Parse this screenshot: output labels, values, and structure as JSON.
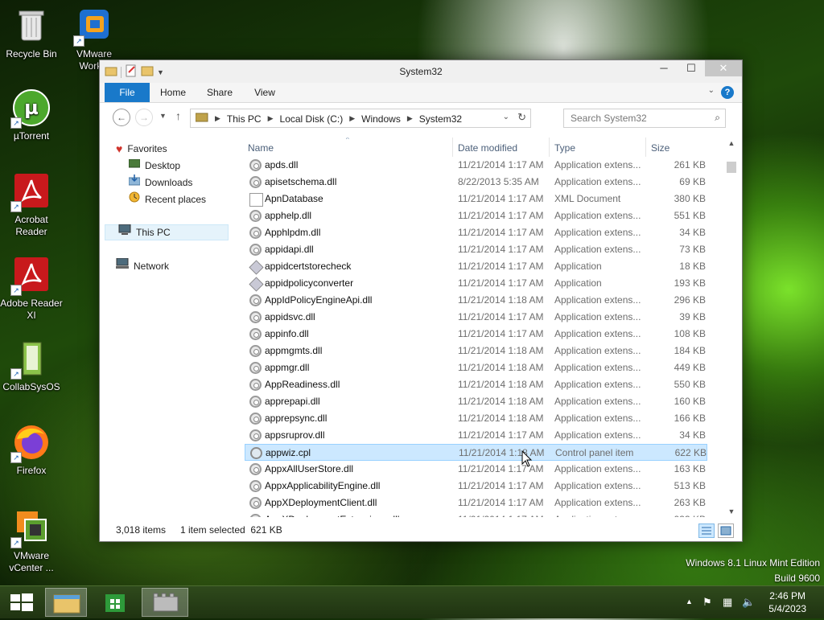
{
  "desktop": {
    "icons": [
      {
        "label": "Recycle Bin",
        "icon": "recycle-bin-icon"
      },
      {
        "label": "VMware Workst",
        "icon": "vmware-workstation-icon"
      },
      {
        "label": "µTorrent",
        "icon": "utorrent-icon"
      },
      {
        "label": "Acrobat Reader",
        "icon": "acrobat-reader-icon"
      },
      {
        "label": "Adobe Reader XI",
        "icon": "adobe-reader-icon"
      },
      {
        "label": "CollabSysOS",
        "icon": "collabsysos-icon"
      },
      {
        "label": "Firefox",
        "icon": "firefox-icon"
      },
      {
        "label": "VMware vCenter ...",
        "icon": "vmware-vcenter-icon"
      }
    ]
  },
  "window": {
    "title": "System32",
    "ribbon": {
      "file": "File",
      "home": "Home",
      "share": "Share",
      "view": "View"
    },
    "address": {
      "crumbs": [
        "This PC",
        "Local Disk (C:)",
        "Windows",
        "System32"
      ]
    },
    "search": {
      "placeholder": "Search System32"
    },
    "nav": {
      "favorites": "Favorites",
      "desktop": "Desktop",
      "downloads": "Downloads",
      "recent": "Recent places",
      "thispc": "This PC",
      "network": "Network"
    },
    "columns": {
      "name": "Name",
      "date": "Date modified",
      "type": "Type",
      "size": "Size"
    },
    "files": [
      {
        "name": "apds.dll",
        "date": "11/21/2014 1:17 AM",
        "type": "Application extens...",
        "size": "261 KB",
        "icon": "gear"
      },
      {
        "name": "apisetschema.dll",
        "date": "8/22/2013 5:35 AM",
        "type": "Application extens...",
        "size": "69 KB",
        "icon": "gear"
      },
      {
        "name": "ApnDatabase",
        "date": "11/21/2014 1:17 AM",
        "type": "XML Document",
        "size": "380 KB",
        "icon": "xml"
      },
      {
        "name": "apphelp.dll",
        "date": "11/21/2014 1:17 AM",
        "type": "Application extens...",
        "size": "551 KB",
        "icon": "gear"
      },
      {
        "name": "Apphlpdm.dll",
        "date": "11/21/2014 1:17 AM",
        "type": "Application extens...",
        "size": "34 KB",
        "icon": "gear"
      },
      {
        "name": "appidapi.dll",
        "date": "11/21/2014 1:17 AM",
        "type": "Application extens...",
        "size": "73 KB",
        "icon": "gear"
      },
      {
        "name": "appidcertstorecheck",
        "date": "11/21/2014 1:17 AM",
        "type": "Application",
        "size": "18 KB",
        "icon": "app"
      },
      {
        "name": "appidpolicyconverter",
        "date": "11/21/2014 1:17 AM",
        "type": "Application",
        "size": "193 KB",
        "icon": "app"
      },
      {
        "name": "AppIdPolicyEngineApi.dll",
        "date": "11/21/2014 1:18 AM",
        "type": "Application extens...",
        "size": "296 KB",
        "icon": "gear"
      },
      {
        "name": "appidsvc.dll",
        "date": "11/21/2014 1:17 AM",
        "type": "Application extens...",
        "size": "39 KB",
        "icon": "gear"
      },
      {
        "name": "appinfo.dll",
        "date": "11/21/2014 1:17 AM",
        "type": "Application extens...",
        "size": "108 KB",
        "icon": "gear"
      },
      {
        "name": "appmgmts.dll",
        "date": "11/21/2014 1:18 AM",
        "type": "Application extens...",
        "size": "184 KB",
        "icon": "gear"
      },
      {
        "name": "appmgr.dll",
        "date": "11/21/2014 1:18 AM",
        "type": "Application extens...",
        "size": "449 KB",
        "icon": "gear"
      },
      {
        "name": "AppReadiness.dll",
        "date": "11/21/2014 1:18 AM",
        "type": "Application extens...",
        "size": "550 KB",
        "icon": "gear"
      },
      {
        "name": "apprepapi.dll",
        "date": "11/21/2014 1:18 AM",
        "type": "Application extens...",
        "size": "160 KB",
        "icon": "gear"
      },
      {
        "name": "apprepsync.dll",
        "date": "11/21/2014 1:18 AM",
        "type": "Application extens...",
        "size": "166 KB",
        "icon": "gear"
      },
      {
        "name": "appsruprov.dll",
        "date": "11/21/2014 1:17 AM",
        "type": "Application extens...",
        "size": "34 KB",
        "icon": "gear"
      },
      {
        "name": "appwiz.cpl",
        "date": "11/21/2014 1:18 AM",
        "type": "Control panel item",
        "size": "622 KB",
        "icon": "cpl",
        "selected": true
      },
      {
        "name": "AppxAllUserStore.dll",
        "date": "11/21/2014 1:17 AM",
        "type": "Application extens...",
        "size": "163 KB",
        "icon": "gear"
      },
      {
        "name": "AppxApplicabilityEngine.dll",
        "date": "11/21/2014 1:17 AM",
        "type": "Application extens...",
        "size": "513 KB",
        "icon": "gear"
      },
      {
        "name": "AppXDeploymentClient.dll",
        "date": "11/21/2014 1:17 AM",
        "type": "Application extens...",
        "size": "263 KB",
        "icon": "gear"
      },
      {
        "name": "AppXDeploymentExtensions.dll",
        "date": "11/21/2014 1:17 AM",
        "type": "Application extens...",
        "size": "933 KB",
        "icon": "gear"
      }
    ],
    "status": {
      "count": "3,018 items",
      "selected": "1 item selected  621 KB"
    }
  },
  "watermark": {
    "line1": "Windows 8.1 Linux Mint Edition",
    "line2": "Build 9600"
  },
  "taskbar": {
    "time": "2:46 PM",
    "date": "5/4/2023"
  }
}
